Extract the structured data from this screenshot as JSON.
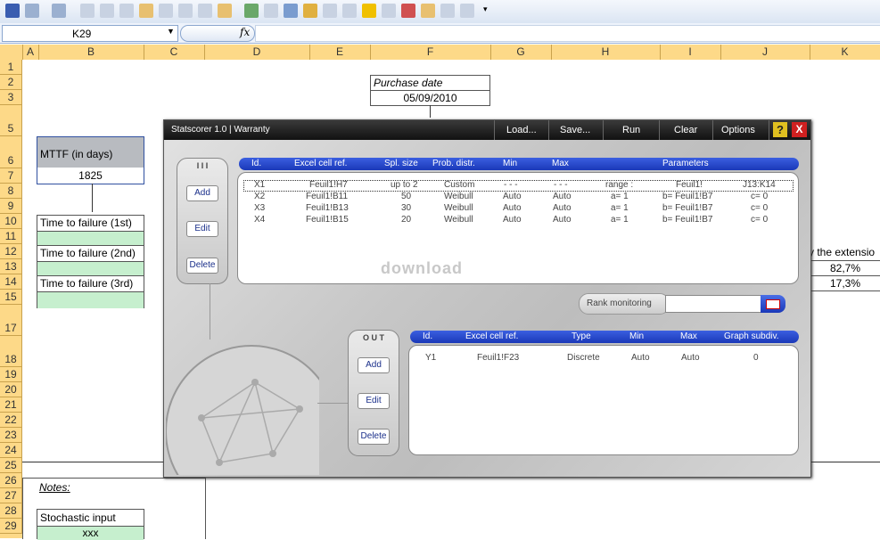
{
  "formula_bar": {
    "name_box": "K29",
    "fx": "fx"
  },
  "columns": [
    "A",
    "B",
    "C",
    "D",
    "E",
    "F",
    "G",
    "H",
    "I",
    "J",
    "K"
  ],
  "rows": [
    "1",
    "2",
    "3",
    "5",
    "6",
    "7",
    "8",
    "9",
    "10",
    "11",
    "12",
    "13",
    "14",
    "15",
    "17",
    "18",
    "19",
    "20",
    "21",
    "22",
    "23",
    "24",
    "25",
    "26",
    "27",
    "28",
    "29"
  ],
  "sheet": {
    "purchase_date_label": "Purchase date",
    "purchase_date_value": "05/09/2010",
    "mttf_label": "MTTF (in days)",
    "mttf_value": "1825",
    "ttf1": "Time to failure (1st)",
    "ttf2": "Time to failure (2nd)",
    "ttf3": "Time to failure (3rd)",
    "extension_label": "y the extensio",
    "pct1": "82,7%",
    "pct2": "17,3%",
    "notes": "Notes:",
    "stochastic_label": "Stochastic input",
    "stochastic_value": "xxx"
  },
  "dialog": {
    "title": "Statscorer 1.0 | Warranty",
    "menu": [
      "Load...",
      "Save...",
      "Run",
      "Clear",
      "Options"
    ],
    "help": "?",
    "close": "X",
    "in_label": "I I I",
    "out_label": "O U T",
    "add": "Add",
    "edit": "Edit",
    "delete": "Delete",
    "in_headers": [
      "Id.",
      "Excel cell ref.",
      "Spl. size",
      "Prob. distr.",
      "Min",
      "Max",
      "Parameters"
    ],
    "in_rows": [
      [
        "X1",
        "Feuil1!H7",
        "up to 2",
        "Custom",
        "- - -",
        "- - -",
        "range :",
        "Feuil1!",
        "J13:K14"
      ],
      [
        "X2",
        "Feuil1!B11",
        "50",
        "Weibull",
        "Auto",
        "Auto",
        "a= 1",
        "b= Feuil1!B7",
        "c= 0"
      ],
      [
        "X3",
        "Feuil1!B13",
        "30",
        "Weibull",
        "Auto",
        "Auto",
        "a= 1",
        "b= Feuil1!B7",
        "c= 0"
      ],
      [
        "X4",
        "Feuil1!B15",
        "20",
        "Weibull",
        "Auto",
        "Auto",
        "a= 1",
        "b= Feuil1!B7",
        "c= 0"
      ]
    ],
    "watermark": "download",
    "rank_monitoring": "Rank monitoring",
    "out_headers": [
      "Id.",
      "Excel cell ref.",
      "Type",
      "Min",
      "Max",
      "Graph subdiv."
    ],
    "out_rows": [
      [
        "Y1",
        "Feuil1!F23",
        "Discrete",
        "Auto",
        "Auto",
        "0"
      ]
    ]
  }
}
